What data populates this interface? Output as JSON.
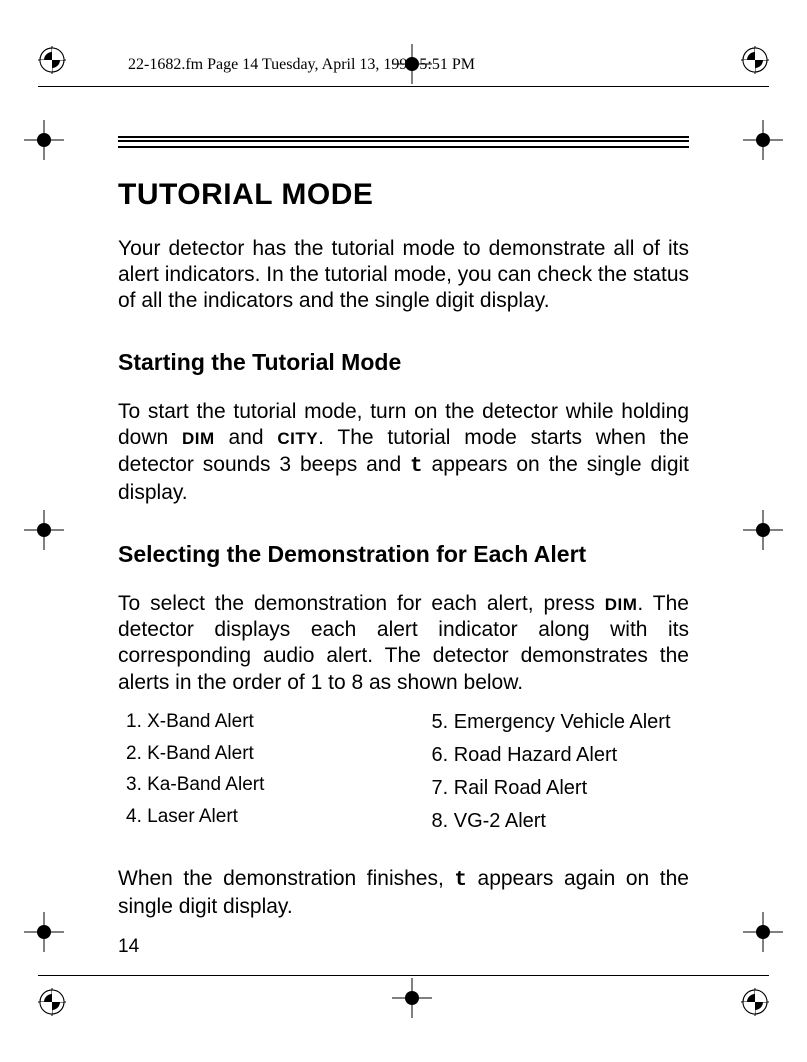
{
  "header": {
    "crop_info": "22-1682.fm  Page 14  Tuesday, April 13, 1999  5:51 PM"
  },
  "title": "TUTORIAL MODE",
  "intro": "Your detector has the tutorial mode to demonstrate all of its alert indicators. In the tutorial mode, you can check the status of all the indicators and the single digit display.",
  "sections": {
    "start": {
      "heading": "Starting the Tutorial Mode",
      "body_pre": "To start the tutorial mode, turn on the detector while holding down ",
      "button1": "DIM",
      "mid1": " and ",
      "button2": "CITY",
      "body_post1": ". The tutorial mode starts when the detector sounds 3 beeps and ",
      "glyph": "t",
      "body_post2": " appears on the single digit display."
    },
    "select": {
      "heading": "Selecting the Demonstration for Each Alert",
      "body_pre": "To select the demonstration for each alert, press ",
      "button1": "DIM",
      "body_post": ". The detector displays each alert indicator along with its corresponding audio alert. The detector demonstrates the alerts in the order of 1 to 8 as shown below."
    }
  },
  "alerts_left": [
    "1. X-Band Alert",
    "2. K-Band Alert",
    "3. Ka-Band Alert",
    "4. Laser Alert"
  ],
  "alerts_right": [
    "5. Emergency Vehicle Alert",
    "6. Road Hazard Alert",
    "7. Rail Road Alert",
    "8. VG-2 Alert"
  ],
  "closing_pre": "When the demonstration finishes, ",
  "closing_glyph": "t",
  "closing_post": " appears again on the single digit display.",
  "pagenum": "14"
}
